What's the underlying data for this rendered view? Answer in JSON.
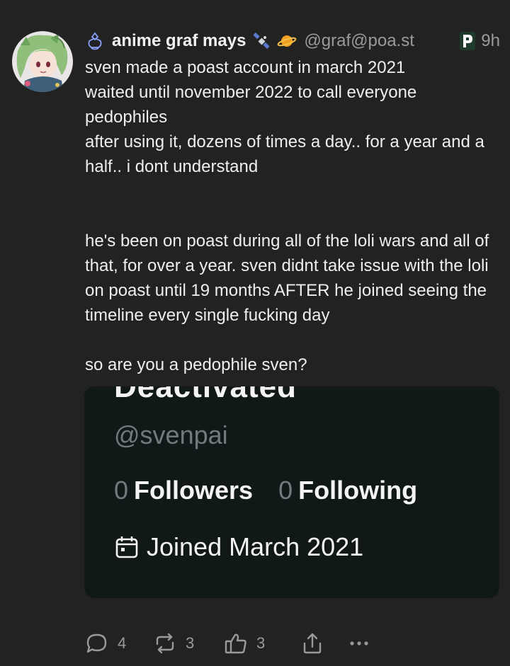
{
  "post": {
    "author": {
      "display_name": "anime graf mays",
      "handle": "@graf@poa.st",
      "name_emojis": [
        "satellite-icon",
        "ringed-planet-icon"
      ],
      "bot_icon": "robot-icon",
      "instance_icon": "pleroma-logo-icon"
    },
    "time": "9h",
    "body": {
      "p1": "sven made a poast account in march 2021",
      "p2": "waited until november 2022 to call everyone pedophiles",
      "p3": "after using it, dozens of times a day.. for a year and a half.. i dont understand",
      "p4": "he's been on poast during all of the loli wars and all of that, for over a year. sven didnt take issue with the loli on poast until 19 months AFTER he joined seeing the timeline every single fucking day",
      "p5": "so are you a pedophile sven?"
    },
    "attachment": {
      "deactivated": "Deactivated",
      "handle": "@svenpai",
      "followers_count": "0",
      "followers_label": "Followers",
      "following_count": "0",
      "following_label": "Following",
      "joined": "Joined March 2021",
      "joined_icon": "calendar-icon"
    },
    "actions": {
      "replies": "4",
      "reposts": "3",
      "likes": "3",
      "reply_icon": "reply-icon",
      "repost_icon": "repost-icon",
      "like_icon": "thumbs-up-icon",
      "share_icon": "share-icon",
      "more_icon": "more-icon"
    }
  },
  "colors": {
    "background": "#222222",
    "text": "#eeeeee",
    "muted": "#9a9a9a",
    "attachment_bg": "#111818",
    "bot_icon": "#8aa0ff"
  }
}
